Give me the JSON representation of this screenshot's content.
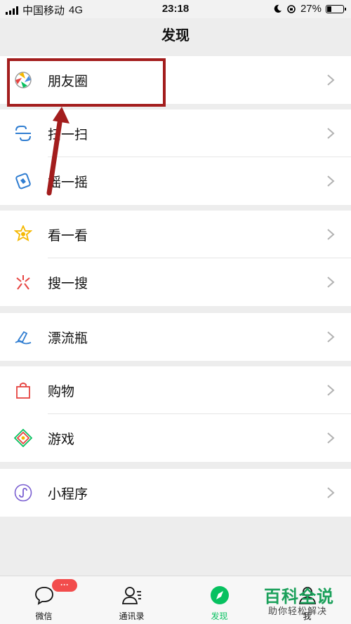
{
  "status_bar": {
    "carrier": "中国移动",
    "network": "4G",
    "time": "23:18",
    "battery_text": "27%",
    "battery_level": 0.27
  },
  "nav": {
    "title": "发现"
  },
  "groups": [
    {
      "items": [
        {
          "label": "朋友圈",
          "icon": "moments-icon"
        }
      ]
    },
    {
      "items": [
        {
          "label": "扫一扫",
          "icon": "scan-icon"
        },
        {
          "label": "摇一摇",
          "icon": "shake-icon"
        }
      ]
    },
    {
      "items": [
        {
          "label": "看一看",
          "icon": "top-stories-icon"
        },
        {
          "label": "搜一搜",
          "icon": "search-icon"
        }
      ]
    },
    {
      "items": [
        {
          "label": "漂流瓶",
          "icon": "drift-bottle-icon"
        }
      ]
    },
    {
      "items": [
        {
          "label": "购物",
          "icon": "shopping-bag-icon"
        },
        {
          "label": "游戏",
          "icon": "games-icon"
        }
      ]
    },
    {
      "items": [
        {
          "label": "小程序",
          "icon": "mini-programs-icon"
        }
      ]
    }
  ],
  "tabs": [
    {
      "label": "微信",
      "icon": "chat-bubble-icon",
      "badge": "···"
    },
    {
      "label": "通讯录",
      "icon": "contacts-icon"
    },
    {
      "label": "发现",
      "icon": "discover-compass-icon",
      "active": true
    },
    {
      "label": "我",
      "icon": "me-icon"
    }
  ],
  "watermark": {
    "main": "百科全说",
    "sub": "助你轻松解决"
  },
  "colors": {
    "accent_green": "#07c160",
    "annotation_red": "#a31d1d",
    "badge_red": "#f24c4c"
  }
}
